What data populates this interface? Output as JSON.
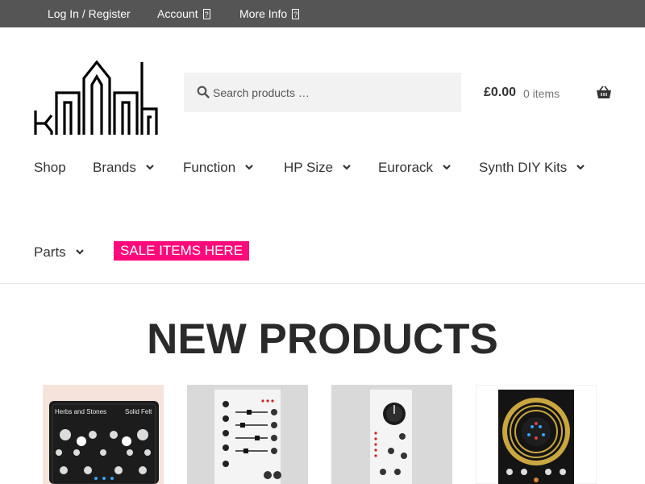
{
  "topbar": {
    "login_label": "Log In / Register",
    "account_label": "Account",
    "more_info_label": "More Info"
  },
  "search": {
    "placeholder": "Search products …"
  },
  "cart": {
    "amount": "£0.00",
    "count": "0 items"
  },
  "nav": {
    "items": [
      {
        "label": "Shop"
      },
      {
        "label": "Brands"
      },
      {
        "label": "Function"
      },
      {
        "label": "HP Size"
      },
      {
        "label": "Eurorack"
      },
      {
        "label": "Synth DIY Kits"
      },
      {
        "label": "Parts"
      }
    ],
    "sale_label": "SALE ITEMS HERE"
  },
  "main": {
    "section_title": "NEW PRODUCTS"
  },
  "products": [
    {
      "panel_text": [
        "Herbs and Stones",
        "Solid Felt"
      ]
    },
    {
      "panel_text": []
    },
    {
      "panel_text": []
    },
    {
      "panel_text": []
    }
  ],
  "colors": {
    "topbar_bg": "#555555",
    "sale_bg": "#ff0a7b",
    "search_bg": "#f2f2f2",
    "text": "#333333"
  }
}
